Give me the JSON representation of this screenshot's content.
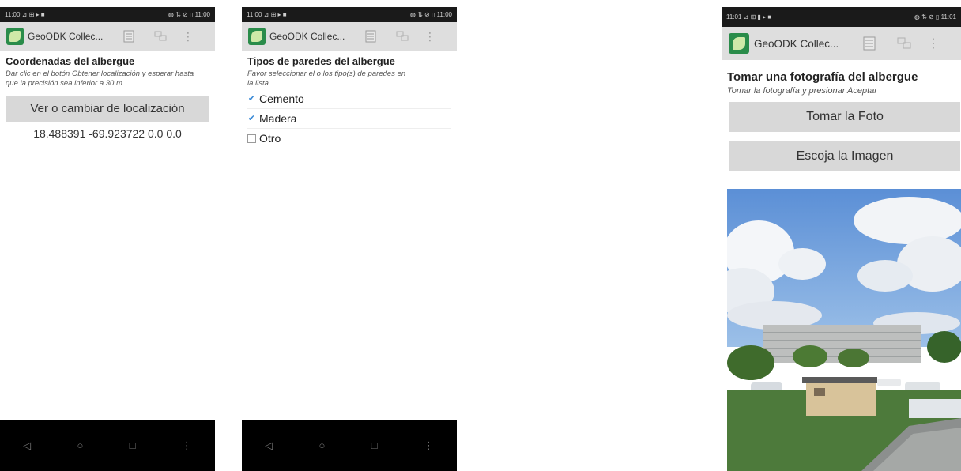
{
  "screens": [
    {
      "status_left": "11:00 ⊿ ⊞ ▸ ■",
      "status_right": "◍ ⇅ ⊘ ▯ 11:00",
      "app_title": "GeoODK Collec...",
      "question_title": "Coordenadas del albergue",
      "question_hint": "Dar clic en el botón Obtener localización y esperar hasta que la precisión sea inferior a 30 m",
      "location_button": "Ver o cambiar de localización",
      "location_value": "18.488391 -69.923722 0.0 0.0",
      "nav": {
        "back": "◁",
        "home": "○",
        "recent": "□",
        "more": "⋮"
      }
    },
    {
      "status_left": "11:00 ⊿ ⊞ ▸ ■",
      "status_right": "◍ ⇅ ⊘ ▯ 11:00",
      "app_title": "GeoODK Collec...",
      "question_title": "Tipos de paredes del albergue",
      "question_hint": "Favor seleccionar el o los tipo(s) de paredes en la lista",
      "choices": [
        {
          "label": "Cemento",
          "checked": true
        },
        {
          "label": "Madera",
          "checked": true
        },
        {
          "label": "Otro",
          "checked": false
        }
      ],
      "nav": {
        "back": "◁",
        "home": "○",
        "recent": "□",
        "more": "⋮"
      }
    },
    {
      "status_left": "11:01 ⊿ ⊞ ▮ ▸ ■",
      "status_right": "◍ ⇅ ⊘ ▯ 11:01",
      "app_title": "GeoODK Collec...",
      "question_title": "Tomar una fotografía del albergue",
      "question_hint": "Tomar la fotografía y presionar Aceptar",
      "take_photo_button": "Tomar la Foto",
      "choose_image_button": "Escoja la Imagen"
    }
  ],
  "icons": {
    "save": "save-icon",
    "language": "language-icon",
    "overflow": "overflow-menu-icon",
    "checked_mark": "✔"
  },
  "colors": {
    "appbar": "#dedede",
    "statusbar": "#1a1a1a",
    "button": "#d8d8d8",
    "checkbox": "#3a8ad6"
  }
}
